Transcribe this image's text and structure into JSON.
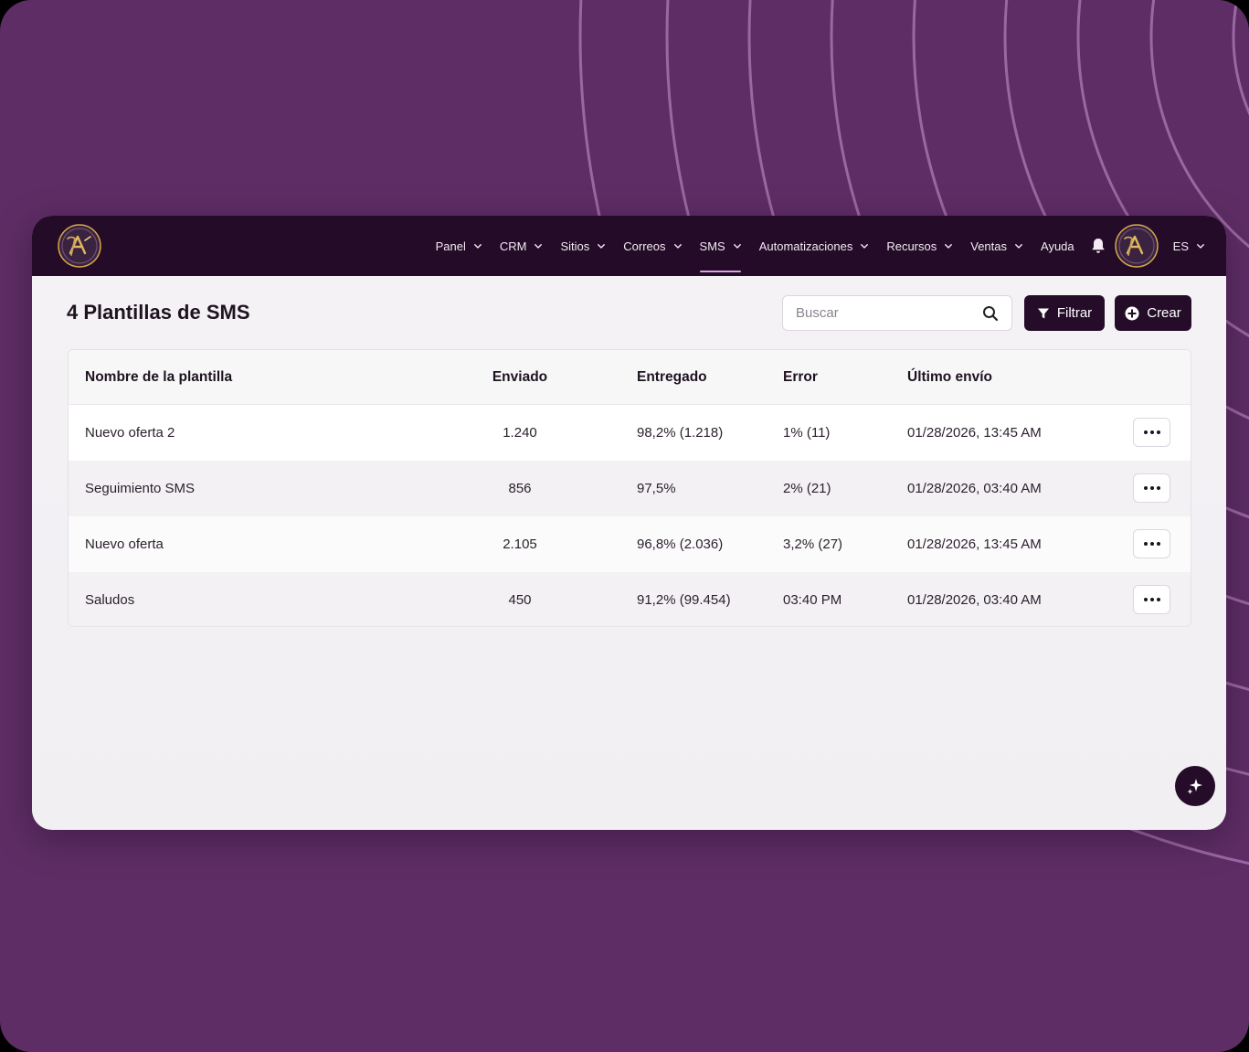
{
  "colors": {
    "background": "#5e2d65",
    "topbar": "#240b27",
    "button": "#250d29",
    "accent_underline": "#d6a6e0",
    "logo_gold": "#d4a94a"
  },
  "nav": {
    "items": [
      {
        "label": "Panel",
        "dropdown": true,
        "active": false
      },
      {
        "label": "CRM",
        "dropdown": true,
        "active": false
      },
      {
        "label": "Sitios",
        "dropdown": true,
        "active": false
      },
      {
        "label": "Correos",
        "dropdown": true,
        "active": false
      },
      {
        "label": "SMS",
        "dropdown": true,
        "active": true
      },
      {
        "label": "Automatizaciones",
        "dropdown": true,
        "active": false
      },
      {
        "label": "Recursos",
        "dropdown": true,
        "active": false
      },
      {
        "label": "Ventas",
        "dropdown": true,
        "active": false
      }
    ],
    "help_label": "Ayuda",
    "language": "ES",
    "icons": {
      "notifications": "bell-icon",
      "logo": "logo-icon",
      "avatar": "avatar-icon"
    }
  },
  "page": {
    "title": "4 Plantillas de SMS",
    "search": {
      "placeholder": "Buscar",
      "value": ""
    },
    "filter_label": "Filtrar",
    "create_label": "Crear"
  },
  "table": {
    "headers": {
      "name": "Nombre de la plantilla",
      "sent": "Enviado",
      "delivered": "Entregado",
      "error": "Error",
      "last_sent": "Último envío"
    },
    "rows": [
      {
        "name": "Nuevo oferta 2",
        "sent": "1.240",
        "delivered": "98,2% (1.218)",
        "error": "1% (11)",
        "last_sent": "01/28/2026, 13:45 AM"
      },
      {
        "name": "Seguimiento SMS",
        "sent": "856",
        "delivered": "97,5%",
        "error": "2% (21)",
        "last_sent": "01/28/2026, 03:40 AM"
      },
      {
        "name": "Nuevo oferta",
        "sent": "2.105",
        "delivered": "96,8% (2.036)",
        "error": "3,2% (27)",
        "last_sent": "01/28/2026, 13:45 AM"
      },
      {
        "name": "Saludos",
        "sent": "450",
        "delivered": "91,2% (99.454)",
        "error": "03:40 PM",
        "last_sent": "01/28/2026, 03:40 AM"
      }
    ],
    "row_action_icon": "more-horizontal-icon"
  },
  "fab": {
    "icon": "sparkles-icon"
  }
}
